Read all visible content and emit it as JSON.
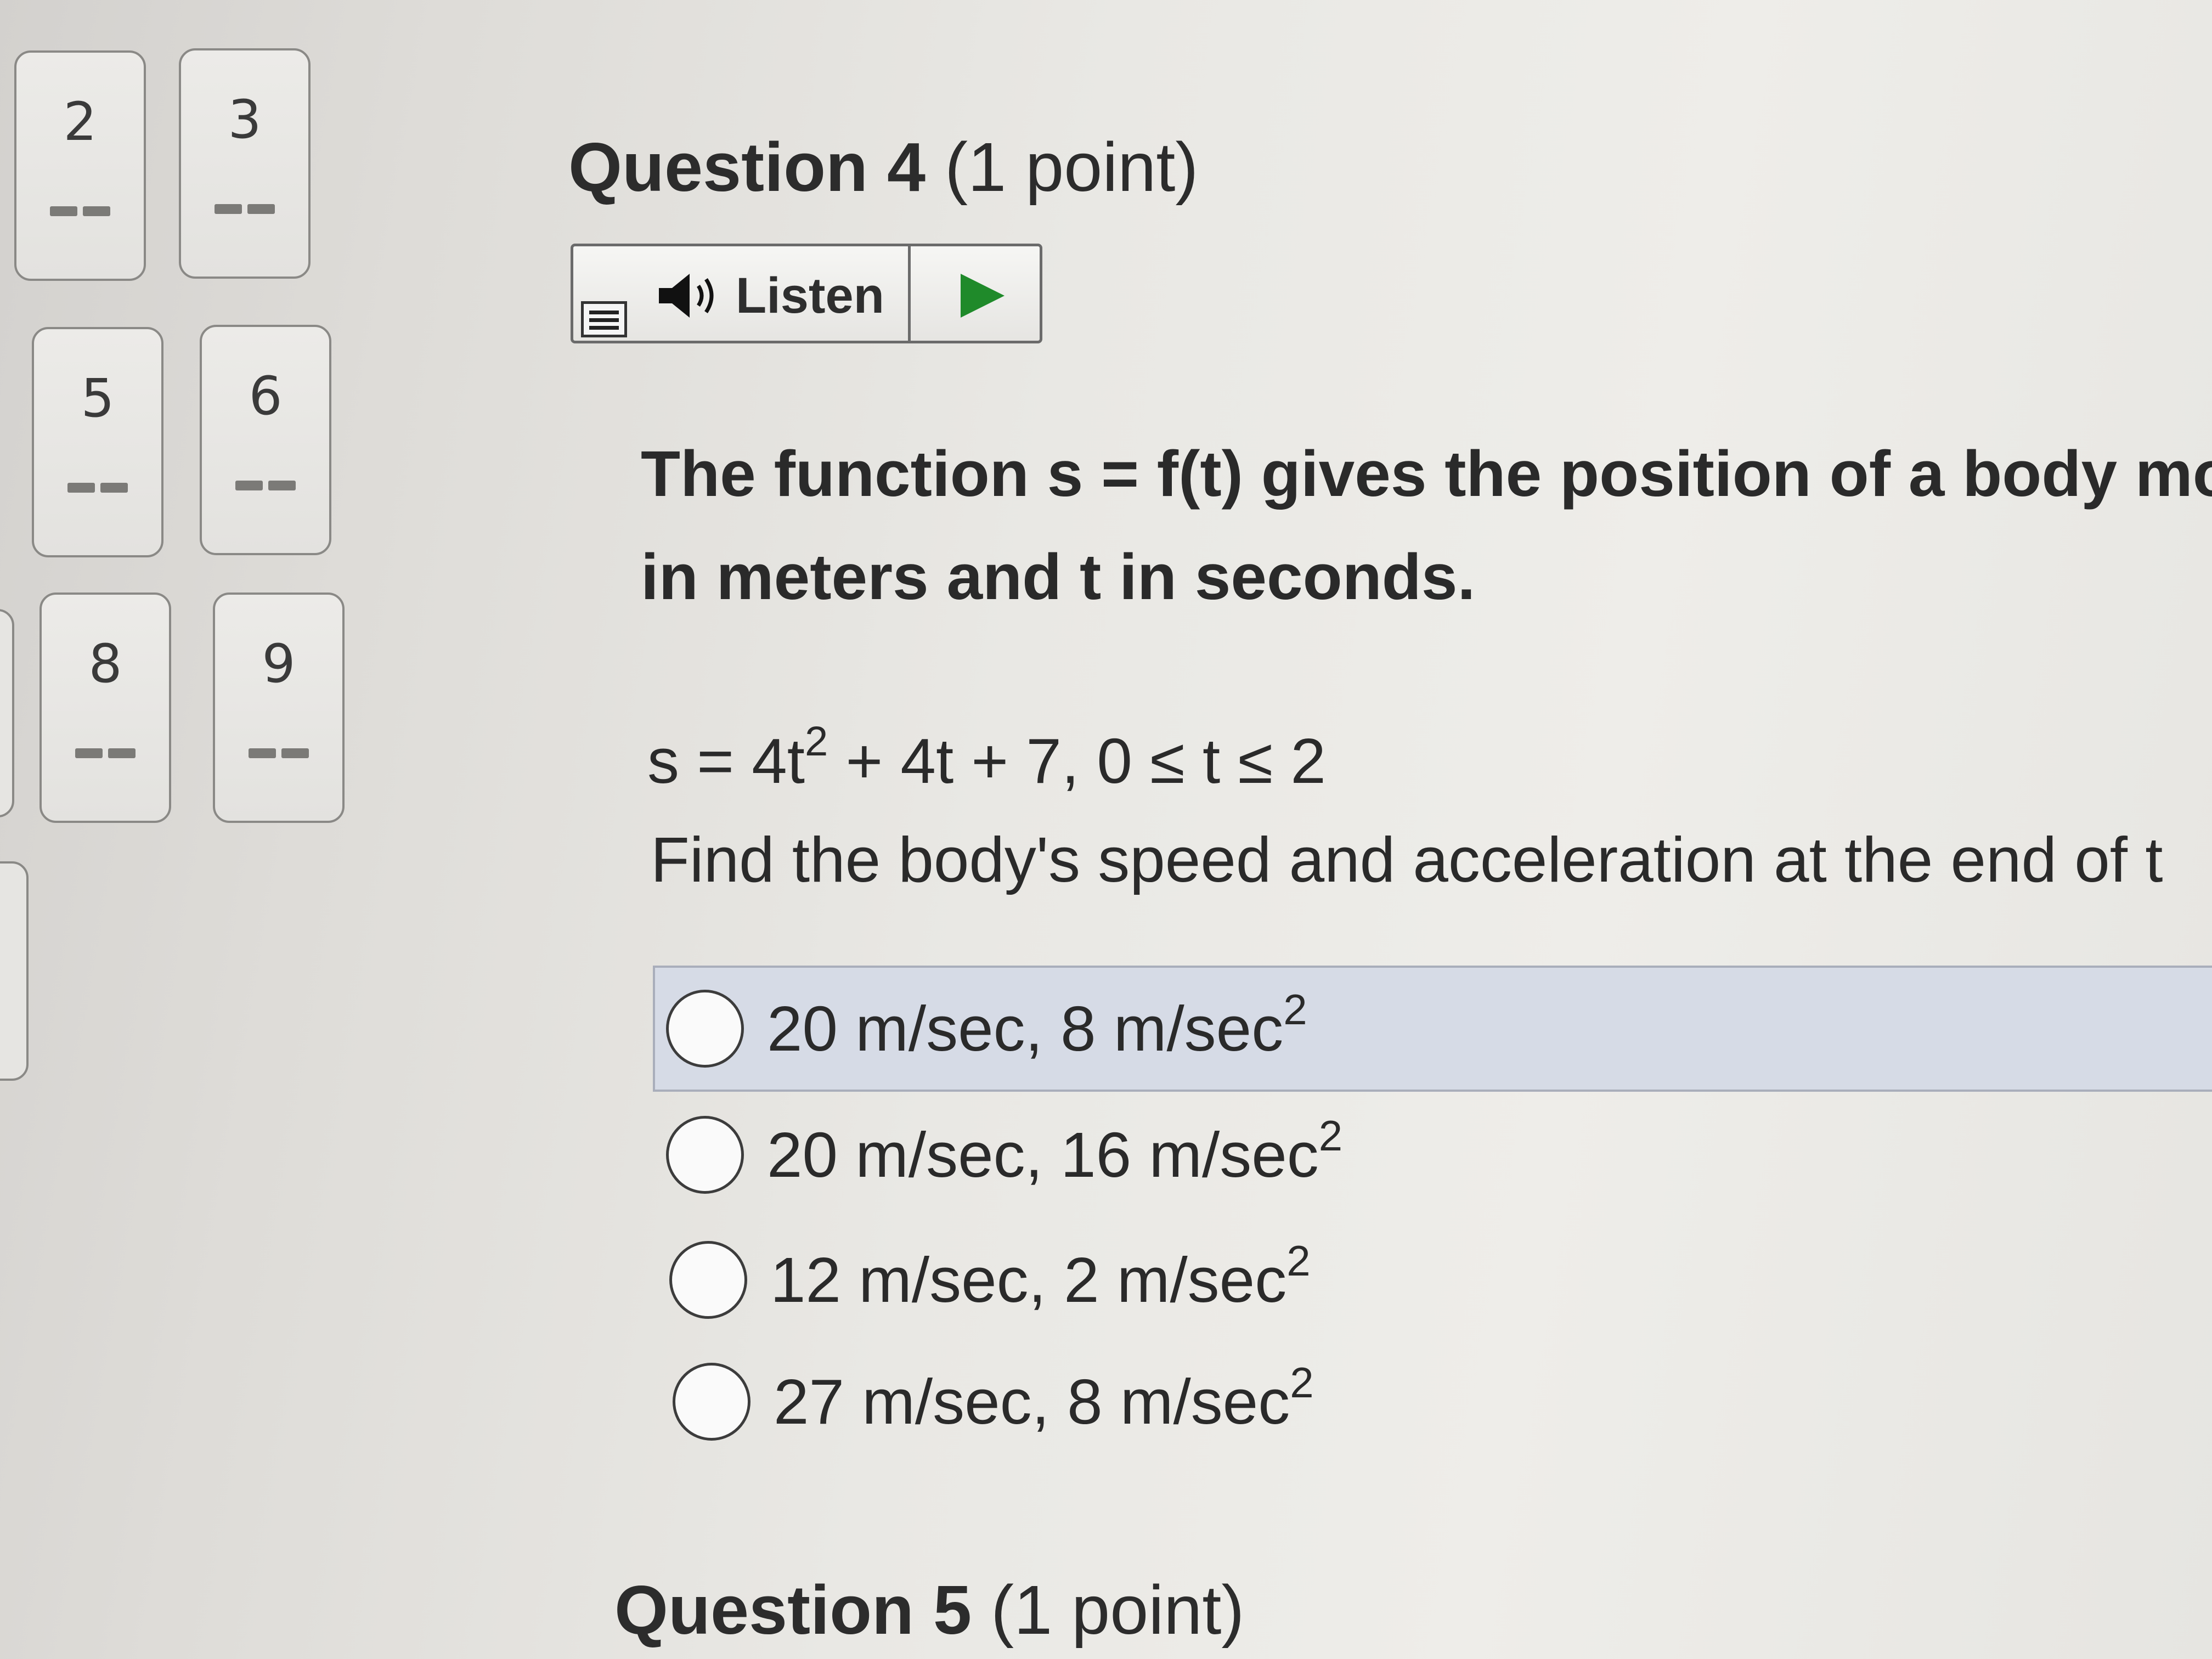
{
  "navigator": {
    "tiles": [
      {
        "number": "2"
      },
      {
        "number": "3"
      },
      {
        "number": "5"
      },
      {
        "number": "6"
      },
      {
        "number": "8"
      },
      {
        "number": "9"
      }
    ]
  },
  "question4": {
    "title": "Question 4",
    "points": "(1 point)",
    "listen_label": "Listen",
    "stem_line1": "The function s = f(t) gives the position of a body mov",
    "stem_line2": "in meters and t in seconds.",
    "equation_lhs": "s = 4t",
    "equation_exp": "2",
    "equation_rhs": " + 4t + 7, 0 ≤ t ≤ 2",
    "prompt": "Find the body's speed and acceleration at the end of t",
    "options": [
      {
        "text": "20 m/sec, 8 m/sec",
        "exp": "2"
      },
      {
        "text": "20 m/sec, 16 m/sec",
        "exp": "2"
      },
      {
        "text": "12 m/sec, 2 m/sec",
        "exp": "2"
      },
      {
        "text": "27 m/sec, 8 m/sec",
        "exp": "2"
      }
    ]
  },
  "question5": {
    "title": "Question 5",
    "points": "(1 point)"
  }
}
